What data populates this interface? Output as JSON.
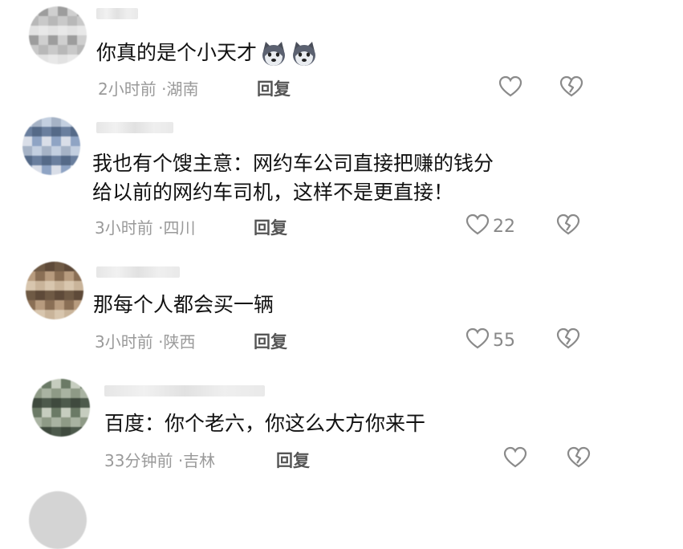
{
  "comments": [
    {
      "text_lines": [
        "你真的是个小天才"
      ],
      "emojis": [
        "husky-face-icon",
        "husky-face-icon"
      ],
      "time": "2小时前",
      "location": "湖南",
      "reply_label": "回复",
      "likes": "",
      "avatar_colors": [
        "#cfcfcf",
        "#b8b8b8",
        "#e2e2e2",
        "#9d9d9d",
        "#c9c9c9",
        "#e8e8e8"
      ]
    },
    {
      "text_lines": [
        "我也有个馊主意：网约车公司直接把赚的钱分",
        "给以前的网约车司机，这样不是更直接！"
      ],
      "emojis": [],
      "time": "3小时前",
      "location": "四川",
      "reply_label": "回复",
      "likes": "22",
      "avatar_colors": [
        "#8fa4c4",
        "#c3cfe0",
        "#6a7f9e",
        "#d9dee8",
        "#a6b3c6",
        "#556a88"
      ]
    },
    {
      "text_lines": [
        "那每个人都会买一辆"
      ],
      "emojis": [],
      "time": "3小时前",
      "location": "陕西",
      "reply_label": "回复",
      "likes": "55",
      "avatar_colors": [
        "#8a6f55",
        "#c9b49a",
        "#5e4a39",
        "#b79b7e",
        "#d8c6ae",
        "#6f5a45"
      ]
    },
    {
      "text_lines": [
        "百度：你个老六，你这么大方你来干"
      ],
      "emojis": [],
      "time": "33分钟前",
      "location": "吉林",
      "reply_label": "回复",
      "likes": "",
      "avatar_colors": [
        "#6b7a66",
        "#a9b3a2",
        "#4d5a4c",
        "#c6cdbf",
        "#8e9a86",
        "#3f4a3e"
      ]
    }
  ],
  "separator": "·",
  "colors": {
    "text": "#111111",
    "meta": "#9a9a9a",
    "reply": "#555555",
    "icon_stroke": "#8a8a8a"
  }
}
